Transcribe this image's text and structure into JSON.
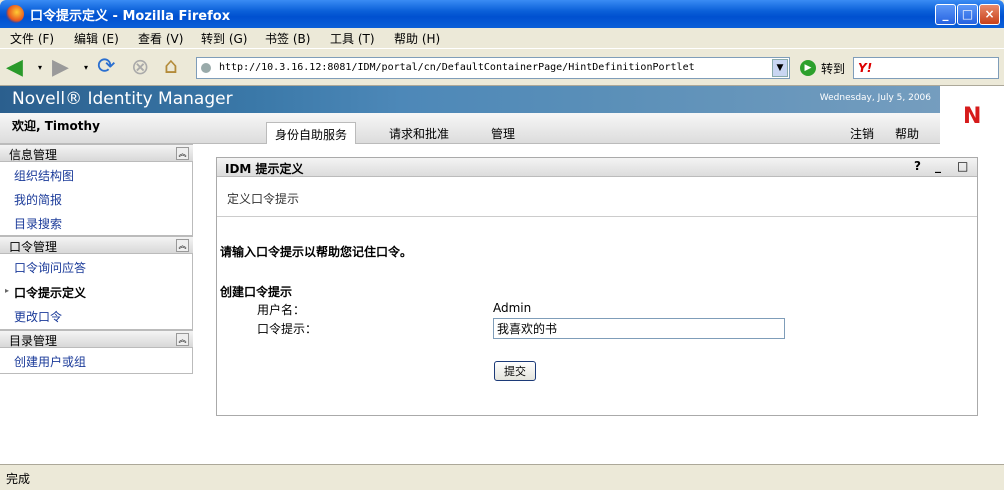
{
  "window": {
    "title": "口令提示定义 - Mozilla Firefox",
    "minimize": "_",
    "maximize": "□",
    "close": "×"
  },
  "menu": {
    "items": [
      "文件 (F)",
      "编辑 (E)",
      "查看 (V)",
      "转到 (G)",
      "书签 (B)",
      "工具 (T)",
      "帮助 (H)"
    ]
  },
  "toolbar": {
    "url": "http://10.3.16.12:8081/IDM/portal/cn/DefaultContainerPage/HintDefinitionPortlet",
    "go_label": "转到",
    "search_logo": "Y!"
  },
  "banner": {
    "product": "Novell® Identity Manager",
    "date": "Wednesday, July 5, 2006",
    "logo": "N"
  },
  "nav": {
    "welcome": "欢迎, Timothy",
    "tabs": [
      "身份自助服务",
      "请求和批准",
      "管理"
    ],
    "logout": "注销",
    "help": "帮助"
  },
  "sidebar": {
    "sections": [
      {
        "title": "信息管理",
        "items": [
          "组织结构图",
          "我的简报",
          "目录搜索"
        ]
      },
      {
        "title": "口令管理",
        "items": [
          "口令询问应答",
          "口令提示定义",
          "更改口令"
        ]
      },
      {
        "title": "目录管理",
        "items": [
          "创建用户或组"
        ]
      }
    ]
  },
  "portlet": {
    "title": "IDM 提示定义",
    "subtitle": "定义口令提示",
    "help": "?",
    "minimize": "_",
    "maximize": "□",
    "instructions": "请输入口令提示以帮助您记住口令。",
    "section": "创建口令提示",
    "username_label": "用户名：",
    "username_value": "Admin",
    "hint_label": "口令提示：",
    "hint_value": "我喜欢的书",
    "submit": "提交"
  },
  "status": {
    "text": "完成"
  }
}
